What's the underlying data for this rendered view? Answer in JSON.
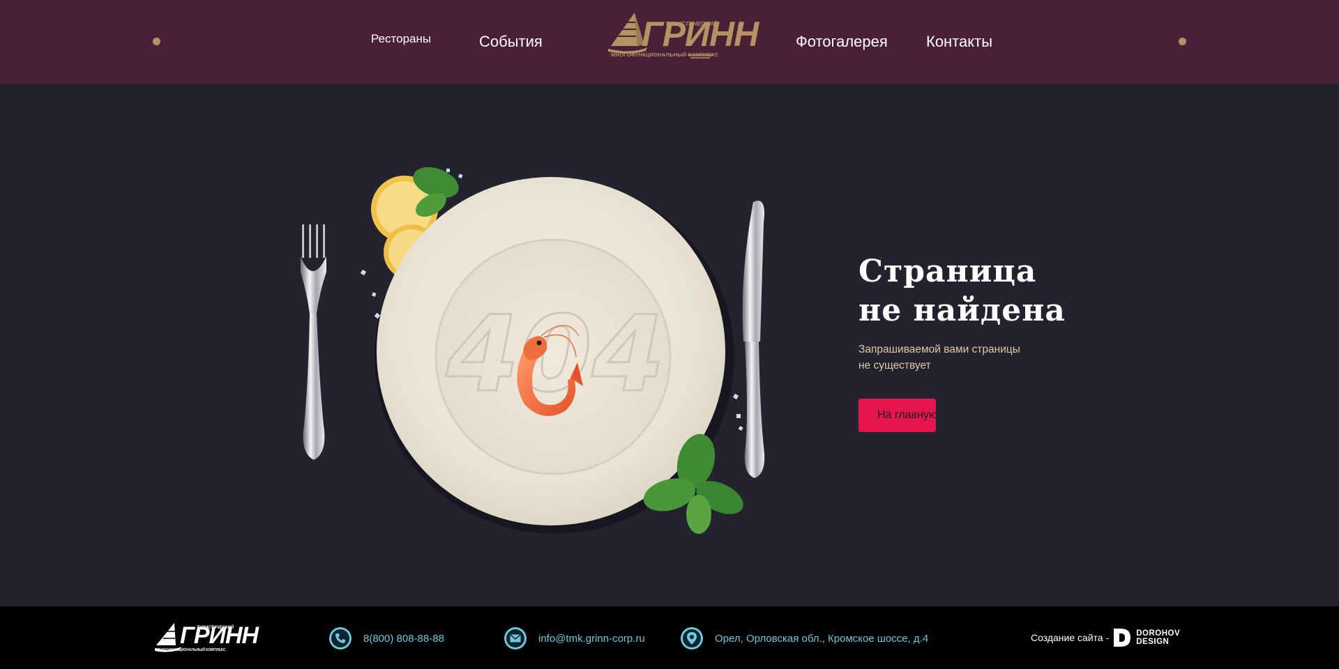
{
  "nav": {
    "left": [
      "Рестораны",
      "События"
    ],
    "right": [
      "Фотогалерея",
      "Контакты"
    ]
  },
  "logo": {
    "main": "ГРИНН",
    "top_text": "ТУРИСТИЧЕСКИЙ",
    "bottom_text": "МНОГОФУНКЦИОНАЛЬНЫЙ КОМПЛЕКС"
  },
  "hero": {
    "plate_number": "404",
    "title_line1": "Страница",
    "title_line2": "не найдена",
    "subtitle_line1": "Запрашиваемой вами страницы",
    "subtitle_line2": "не существует",
    "button_label": "На главную"
  },
  "footer": {
    "phone": "8(800) 808-88-88",
    "email": "info@tmk.grinn-corp.ru",
    "address": "Орел, Орловская обл., Кромское шоссе, д.4",
    "credit_label": "Создание сайта -",
    "credit_name_line1": "DOROHOV",
    "credit_name_line2": "DESIGN"
  },
  "colors": {
    "header_bg": "#4a1f38",
    "main_bg": "#22232f",
    "footer_bg": "#010101",
    "gold": "#b59262",
    "accent_button": "#e5164e",
    "footer_link": "#70c6d8",
    "subtitle_text": "#e3c9a8"
  },
  "icons": [
    "phone-icon",
    "mail-icon",
    "location-pin-icon",
    "dorohov-design-logo-icon"
  ]
}
